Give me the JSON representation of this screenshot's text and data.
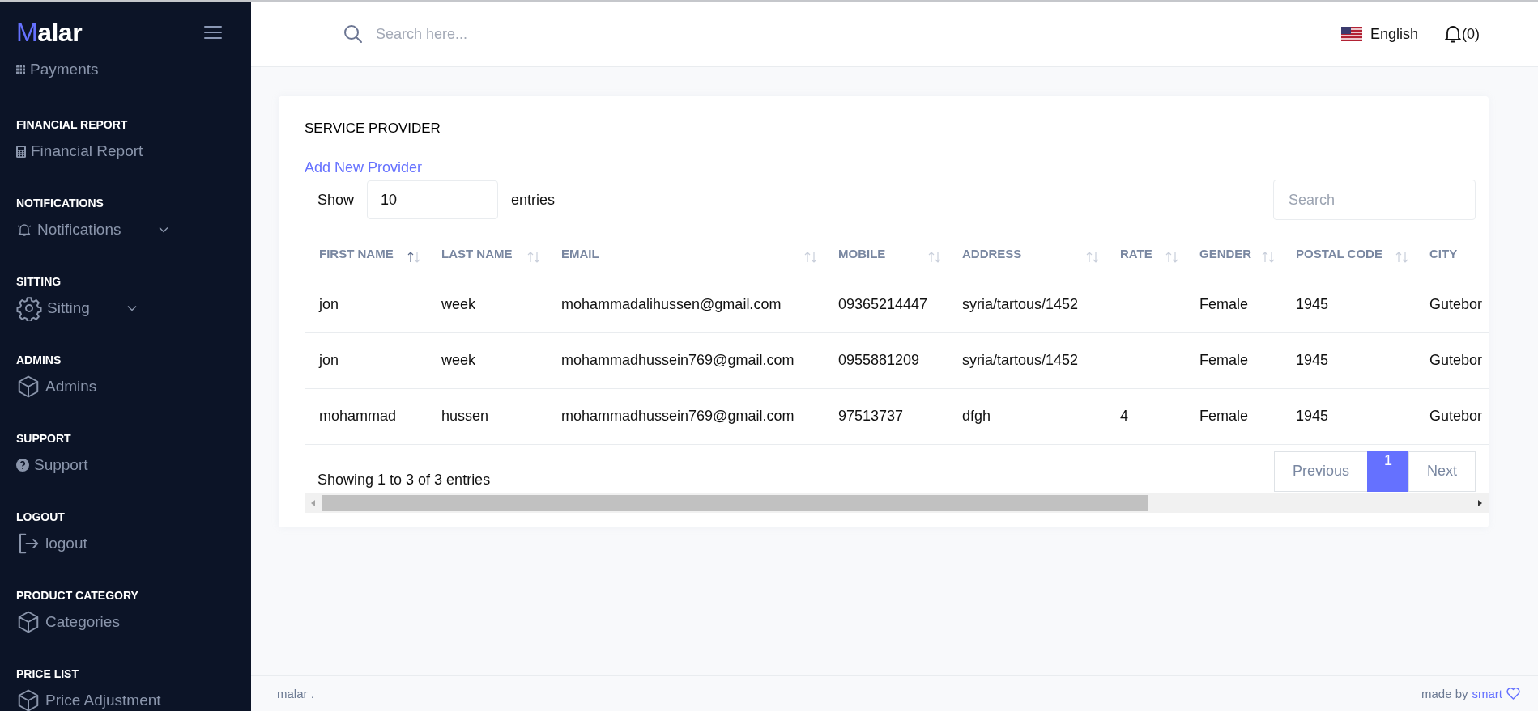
{
  "sidebar": {
    "logo": {
      "accent": "M",
      "rest": "alar"
    },
    "top_item": {
      "label": "Payments"
    },
    "sections": [
      {
        "heading": "FINANCIAL REPORT",
        "item": {
          "label": "Financial Report",
          "expandable": false
        }
      },
      {
        "heading": "NOTIFICATIONS",
        "item": {
          "label": "Notifications",
          "expandable": true
        }
      },
      {
        "heading": "SITTING",
        "item": {
          "label": "Sitting",
          "expandable": true
        }
      },
      {
        "heading": "ADMINS",
        "item": {
          "label": "Admins",
          "expandable": false
        }
      },
      {
        "heading": "SUPPORT",
        "item": {
          "label": "Support",
          "expandable": false
        }
      },
      {
        "heading": "LOGOUT",
        "item": {
          "label": "logout",
          "expandable": false
        }
      },
      {
        "heading": "PRODUCT CATEGORY",
        "item": {
          "label": "Categories",
          "expandable": false
        }
      },
      {
        "heading": "PRICE LIST",
        "item": {
          "label": "Price Adjustment",
          "expandable": false
        }
      }
    ]
  },
  "header": {
    "search": {
      "placeholder": "Search here..."
    },
    "language": "English",
    "notifications": "(0)"
  },
  "card": {
    "title": "SERVICE PROVIDER",
    "add_link": "Add New Provider",
    "length": {
      "before": "Show",
      "value": "10",
      "after": "entries"
    },
    "search": {
      "placeholder": "Search"
    },
    "table": {
      "columns": [
        {
          "label": "FIRST NAME",
          "sortable": true,
          "sorted": true
        },
        {
          "label": "LAST NAME",
          "sortable": true,
          "sorted": false
        },
        {
          "label": "EMAIL",
          "sortable": true,
          "sorted": false
        },
        {
          "label": "MOBILE",
          "sortable": true,
          "sorted": false
        },
        {
          "label": "ADDRESS",
          "sortable": true,
          "sorted": false
        },
        {
          "label": "RATE",
          "sortable": true,
          "sorted": false
        },
        {
          "label": "GENDER",
          "sortable": true,
          "sorted": false
        },
        {
          "label": "POSTAL CODE",
          "sortable": true,
          "sorted": false
        },
        {
          "label": "CITY"
        }
      ],
      "rows": [
        [
          "jon",
          "week",
          "mohammadalihussen@gmail.com",
          "09365214447",
          "syria/tartous/1452",
          "",
          "Female",
          "1945",
          "Gutebor"
        ],
        [
          "jon",
          "week",
          "mohammadhussein769@gmail.com",
          "0955881209",
          "syria/tartous/1452",
          "",
          "Female",
          "1945",
          "Gutebor"
        ],
        [
          "mohammad",
          "hussen",
          "mohammadhussein769@gmail.com",
          "97513737",
          "dfgh",
          "4",
          "Female",
          "1945",
          "Gutebor"
        ]
      ]
    },
    "info": "Showing 1 to 3 of 3 entries",
    "pagination": [
      {
        "label": "Previous",
        "kind": "nav",
        "selected": false
      },
      {
        "label": "1",
        "kind": "page",
        "selected": true
      },
      {
        "label": "Next",
        "kind": "nav",
        "selected": false
      }
    ]
  },
  "footer": {
    "left": "malar .",
    "made_by": "made by",
    "link": "smart"
  }
}
